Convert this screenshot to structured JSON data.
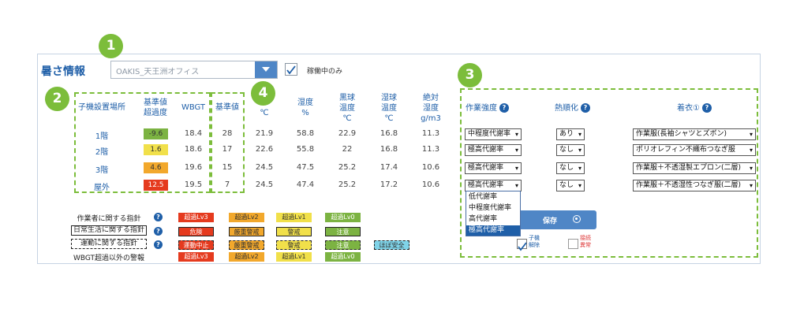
{
  "header": {
    "title": "暑さ情報",
    "location": "OAKIS_天王洲オフィス",
    "active_only_label": "稼働中のみ"
  },
  "badges": [
    "1",
    "2",
    "3",
    "4"
  ],
  "columns": {
    "location": "子機設置場所",
    "ref_exceed": [
      "基準値",
      "超過度"
    ],
    "wbgt": "WBGT",
    "ref_value": "基準値",
    "temp": "℃",
    "humidity": [
      "湿度",
      "%"
    ],
    "globe": [
      "黒球",
      "温度",
      "℃"
    ],
    "wet": [
      "湿球",
      "温度",
      "℃"
    ],
    "abs_humidity": [
      "絶対",
      "湿度",
      "g/m3"
    ]
  },
  "rows": [
    {
      "location": "1階",
      "exceed": "-9.6",
      "exceed_color": "#7cb342",
      "wbgt": "18.4",
      "ref": "28",
      "temp": "21.9",
      "humidity": "58.8",
      "globe": "22.9",
      "wet": "16.8",
      "abs": "11.3",
      "intensity": "中程度代謝率",
      "acclimatized": "あり",
      "clothing": "作業服(長袖シャツとズボン)"
    },
    {
      "location": "2階",
      "exceed": "1.6",
      "exceed_color": "#f1e04a",
      "wbgt": "18.6",
      "ref": "17",
      "temp": "22.6",
      "humidity": "55.8",
      "globe": "22",
      "wet": "16.8",
      "abs": "11.3",
      "intensity": "極高代謝率",
      "acclimatized": "なし",
      "clothing": "ポリオレフィン不織布つなぎ服"
    },
    {
      "location": "3階",
      "exceed": "4.6",
      "exceed_color": "#f2a82c",
      "wbgt": "19.6",
      "ref": "15",
      "temp": "24.5",
      "humidity": "47.5",
      "globe": "25.2",
      "wet": "17.4",
      "abs": "10.6",
      "intensity": "極高代謝率",
      "acclimatized": "なし",
      "clothing": "作業服＋不透湿製エプロン(二層)"
    },
    {
      "location": "屋外",
      "exceed": "12.5",
      "exceed_color": "#e53a1e",
      "wbgt": "19.5",
      "ref": "7",
      "temp": "24.5",
      "humidity": "47.4",
      "globe": "25.2",
      "wet": "17.2",
      "abs": "10.6",
      "intensity": "極高代謝率",
      "acclimatized": "なし",
      "clothing": "作業服＋不透湿性つなぎ服(二層)"
    }
  ],
  "settings": {
    "intensity_header": "作業強度",
    "acclimatization_header": "熱順化",
    "clothing_header": "着衣①",
    "help_glyph": "?",
    "dropdown_options": [
      "低代謝率",
      "中程度代謝率",
      "高代謝率",
      "極高代謝率"
    ],
    "dropdown_selected": 3,
    "save_label": "保存",
    "mobile_release_label": [
      "子機",
      "解除"
    ],
    "abnormal_label": [
      "接続",
      "異常"
    ]
  },
  "legend": {
    "rows": [
      {
        "label": "作業者に関する指針",
        "chips": [
          "超過Lv3",
          "超過Lv2",
          "超過Lv1",
          "超過Lv0"
        ],
        "colors": [
          "#e53a1e",
          "#f2a82c",
          "#f1e04a",
          "#7cb342"
        ]
      },
      {
        "label": "日常生活に関する指針",
        "chips": [
          "危険",
          "厳重警戒",
          "警戒",
          "注意"
        ],
        "colors": [
          "#e53a1e",
          "#f2a82c",
          "#f1e04a",
          "#7cb342"
        ]
      },
      {
        "label": "運動に関する指針",
        "chips": [
          "運動中止",
          "厳重警戒",
          "警戒",
          "注意",
          "ほぼ安全"
        ],
        "colors": [
          "#e53a1e",
          "#f2a82c",
          "#f1e04a",
          "#7cb342",
          "#7fd3e8"
        ]
      },
      {
        "label": "WBGT超過以外の警報",
        "chips": [
          "超過Lv3",
          "超過Lv2",
          "超過Lv1",
          "超過Lv0"
        ],
        "colors": [
          "#e53a1e",
          "#f2a82c",
          "#f1e04a",
          "#7cb342"
        ]
      }
    ]
  }
}
